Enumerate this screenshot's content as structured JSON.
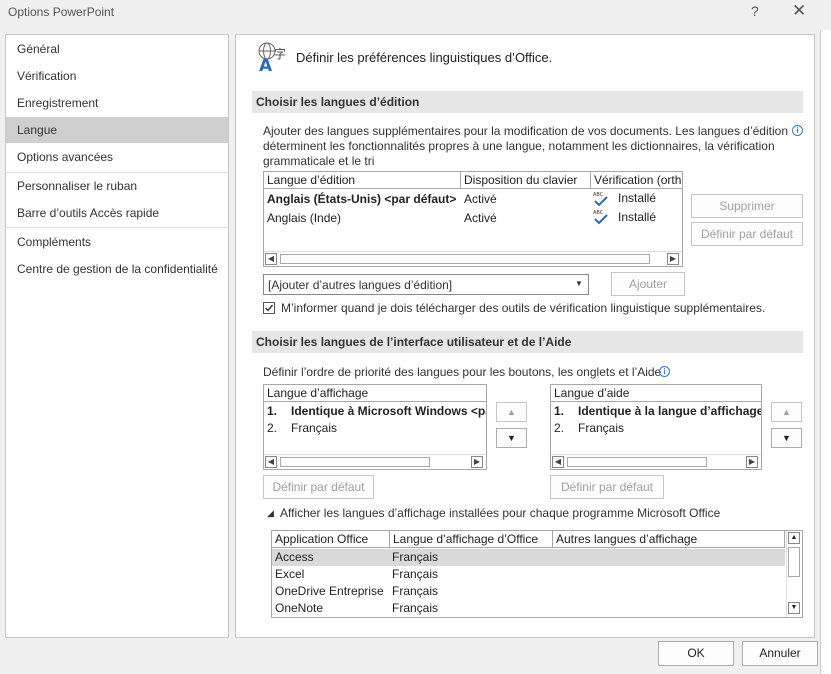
{
  "window": {
    "title": "Options PowerPoint",
    "help_icon": "?",
    "close_icon": "✕"
  },
  "sidebar": {
    "items": [
      {
        "label": "Général"
      },
      {
        "label": "Vérification"
      },
      {
        "label": "Enregistrement"
      },
      {
        "label": "Langue",
        "selected": true
      },
      {
        "label": "Options avancées"
      },
      {
        "label": "Personnaliser le ruban"
      },
      {
        "label": "Barre d’outils Accès rapide"
      },
      {
        "label": "Compléments"
      },
      {
        "label": "Centre de gestion de la confidentialité"
      }
    ]
  },
  "main": {
    "heading": "Définir les préférences linguistiques d’Office.",
    "editing": {
      "section_title": "Choisir les langues d’édition",
      "description_lines": [
        "Ajouter des langues supplémentaires pour la modification de vos documents. Les langues d’édition",
        "déterminent les fonctionnalités propres à une langue, notamment les dictionnaires, la vérification",
        "grammaticale et le tri"
      ],
      "columns": [
        "Langue d’édition",
        "Disposition du clavier",
        "Vérification (orth"
      ],
      "rows": [
        {
          "language": "Anglais (États-Unis) <par défaut>",
          "keyboard": "Activé",
          "proofing": "Installé",
          "bold": true
        },
        {
          "language": "Anglais (Inde)",
          "keyboard": "Activé",
          "proofing": "Installé",
          "bold": false
        }
      ],
      "remove_button": "Supprimer",
      "set_default_button": "Définir par défaut",
      "add_dropdown": "[Ajouter d’autres langues d’édition]",
      "add_button": "Ajouter",
      "notify_checkbox": {
        "checked": true,
        "label": "M’informer quand je dois télécharger des outils de vérification linguistique supplémentaires."
      }
    },
    "ui": {
      "section_title": "Choisir les langues de l’interface utilisateur et de l’Aide",
      "description": "Définir l’ordre de priorité des langues pour les boutons, les onglets et l’Aide",
      "display_list": {
        "header": "Langue d’affichage",
        "items": [
          {
            "num": "1.",
            "label": "Identique à Microsoft Windows <par défaut>",
            "bold": true
          },
          {
            "num": "2.",
            "label": "Français",
            "bold": false
          }
        ]
      },
      "help_list": {
        "header": "Langue d’aide",
        "items": [
          {
            "num": "1.",
            "label": "Identique à la langue d’affichage",
            "bold": true
          },
          {
            "num": "2.",
            "label": "Français",
            "bold": false
          }
        ]
      },
      "display_set_default": "Définir par défaut",
      "help_set_default": "Définir par défaut",
      "show_installed_label": "Afficher les langues d’affichage installées pour chaque programme Microsoft Office",
      "apps_table": {
        "columns": [
          "Application Office",
          "Langue d’affichage d’Office",
          "Autres langues d’affichage"
        ],
        "rows": [
          {
            "app": "Access",
            "lang": "Français",
            "selected": true
          },
          {
            "app": "Excel",
            "lang": "Français"
          },
          {
            "app": "OneDrive Entreprise",
            "lang": "Français"
          },
          {
            "app": "OneNote",
            "lang": "Français"
          }
        ]
      }
    }
  },
  "footer": {
    "ok": "OK",
    "cancel": "Annuler"
  }
}
